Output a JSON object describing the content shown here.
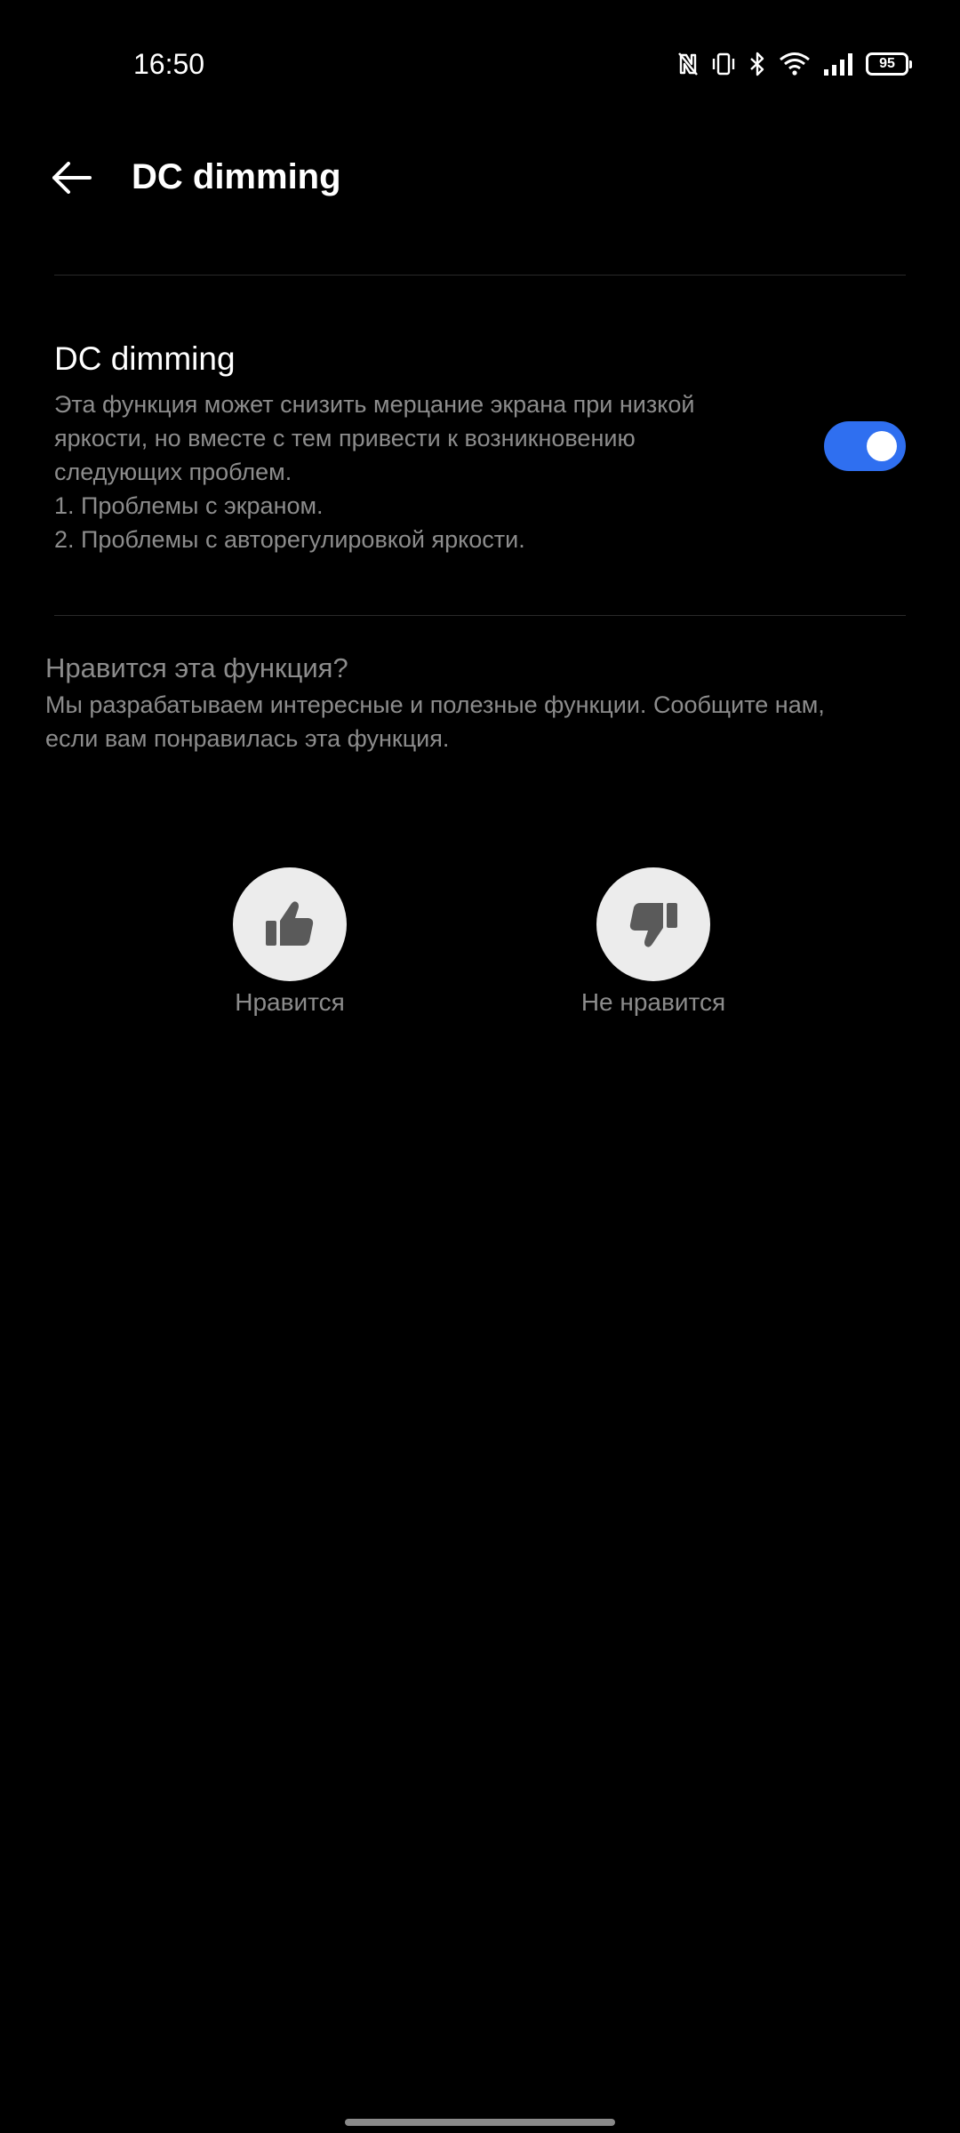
{
  "status_bar": {
    "time": "16:50",
    "battery_level": "95",
    "icons": [
      "nfc-icon",
      "vibrate-icon",
      "bluetooth-icon",
      "wifi-icon",
      "signal-icon",
      "battery-icon"
    ]
  },
  "header": {
    "title": "DC dimming",
    "back_icon": "arrow-left-icon"
  },
  "setting": {
    "title": "DC dimming",
    "description_lines": [
      "Эта функция может снизить мерцание экрана при низкой",
      "яркости, но вместе с тем привести к возникновению",
      "следующих проблем.",
      "1. Проблемы с экраном.",
      "2. Проблемы с авторегулировкой яркости."
    ],
    "toggle_on": true
  },
  "feedback": {
    "title": "Нравится эта функция?",
    "description_lines": [
      "Мы разрабатываем интересные и полезные функции. Сообщите нам,",
      "если вам понравилась эта функция."
    ],
    "like_label": "Нравится",
    "dislike_label": "Не нравится"
  },
  "colors": {
    "background": "#000000",
    "accent": "#2f6ff0",
    "secondary_text": "#8c8c8c",
    "button_circle": "#ececec",
    "icon_dark": "#5a5a5a"
  }
}
